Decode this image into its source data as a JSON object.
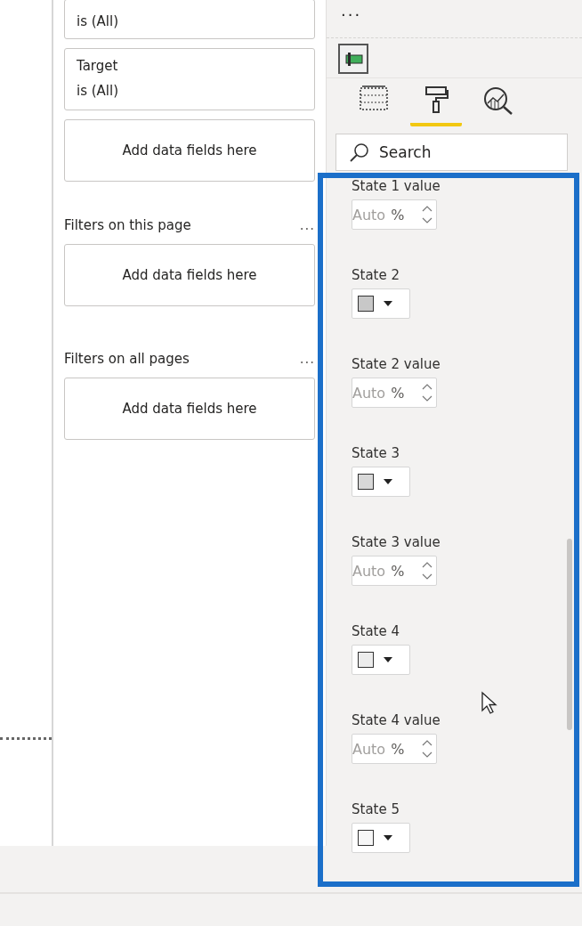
{
  "filters_pane": {
    "cards": [
      {
        "kind": "filter",
        "condition": "is (All)"
      },
      {
        "kind": "filter",
        "field": "Target",
        "condition": "is (All)"
      },
      {
        "kind": "drop",
        "text": "Add data fields here"
      }
    ],
    "sections": [
      {
        "title": "Filters on this page",
        "more": "...",
        "drop": "Add data fields here"
      },
      {
        "title": "Filters on all pages",
        "more": "...",
        "drop": "Add data fields here"
      }
    ]
  },
  "format_pane": {
    "more": "...",
    "tabs": [
      {
        "kind": "fields",
        "selected": false
      },
      {
        "kind": "format",
        "selected": true
      },
      {
        "kind": "analytics",
        "selected": false
      }
    ],
    "search": {
      "placeholder": "Search"
    },
    "items": [
      {
        "kind": "percent",
        "label": "State 1 value",
        "value": "Auto",
        "unit": "%"
      },
      {
        "kind": "color",
        "label": "State 2",
        "color": "#c8c8c8"
      },
      {
        "kind": "percent",
        "label": "State 2 value",
        "value": "Auto",
        "unit": "%"
      },
      {
        "kind": "color",
        "label": "State 3",
        "color": "#d8d8d8"
      },
      {
        "kind": "percent",
        "label": "State 3 value",
        "value": "Auto",
        "unit": "%"
      },
      {
        "kind": "color",
        "label": "State 4",
        "color": "#ececec"
      },
      {
        "kind": "percent",
        "label": "State 4 value",
        "value": "Auto",
        "unit": "%"
      },
      {
        "kind": "color",
        "label": "State 5",
        "color": "#f6f6f6"
      }
    ]
  }
}
